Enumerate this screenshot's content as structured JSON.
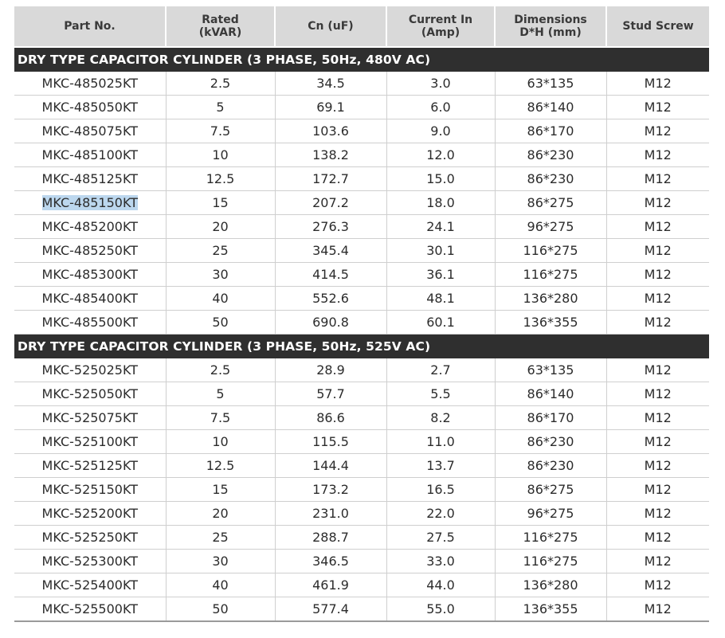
{
  "table": {
    "headers": {
      "part_no": "Part No.",
      "rated_1": "Rated",
      "rated_2": "(kVAR)",
      "cn": "Cn (uF)",
      "current_1": "Current In",
      "current_2": "(Amp)",
      "dims_1": "Dimensions",
      "dims_2": "D*H (mm)",
      "stud": "Stud Screw"
    },
    "sections": [
      {
        "title": "DRY TYPE CAPACITOR CYLINDER (3 PHASE, 50Hz, 480V AC)",
        "rows": [
          {
            "part": "MKC-485025KT",
            "rated": "2.5",
            "cn": "34.5",
            "current": "3.0",
            "dims": "63*135",
            "stud": "M12"
          },
          {
            "part": "MKC-485050KT",
            "rated": "5",
            "cn": "69.1",
            "current": "6.0",
            "dims": "86*140",
            "stud": "M12"
          },
          {
            "part": "MKC-485075KT",
            "rated": "7.5",
            "cn": "103.6",
            "current": "9.0",
            "dims": "86*170",
            "stud": "M12"
          },
          {
            "part": "MKC-485100KT",
            "rated": "10",
            "cn": "138.2",
            "current": "12.0",
            "dims": "86*230",
            "stud": "M12"
          },
          {
            "part": "MKC-485125KT",
            "rated": "12.5",
            "cn": "172.7",
            "current": "15.0",
            "dims": "86*230",
            "stud": "M12"
          },
          {
            "part": "MKC-485150KT",
            "rated": "15",
            "cn": "207.2",
            "current": "18.0",
            "dims": "86*275",
            "stud": "M12"
          },
          {
            "part": "MKC-485200KT",
            "rated": "20",
            "cn": "276.3",
            "current": "24.1",
            "dims": "96*275",
            "stud": "M12"
          },
          {
            "part": "MKC-485250KT",
            "rated": "25",
            "cn": "345.4",
            "current": "30.1",
            "dims": "116*275",
            "stud": "M12"
          },
          {
            "part": "MKC-485300KT",
            "rated": "30",
            "cn": "414.5",
            "current": "36.1",
            "dims": "116*275",
            "stud": "M12"
          },
          {
            "part": "MKC-485400KT",
            "rated": "40",
            "cn": "552.6",
            "current": "48.1",
            "dims": "136*280",
            "stud": "M12"
          },
          {
            "part": "MKC-485500KT",
            "rated": "50",
            "cn": "690.8",
            "current": "60.1",
            "dims": "136*355",
            "stud": "M12"
          }
        ]
      },
      {
        "title": "DRY TYPE CAPACITOR CYLINDER (3 PHASE, 50Hz, 525V AC)",
        "rows": [
          {
            "part": "MKC-525025KT",
            "rated": "2.5",
            "cn": "28.9",
            "current": "2.7",
            "dims": "63*135",
            "stud": "M12"
          },
          {
            "part": "MKC-525050KT",
            "rated": "5",
            "cn": "57.7",
            "current": "5.5",
            "dims": "86*140",
            "stud": "M12"
          },
          {
            "part": "MKC-525075KT",
            "rated": "7.5",
            "cn": "86.6",
            "current": "8.2",
            "dims": "86*170",
            "stud": "M12"
          },
          {
            "part": "MKC-525100KT",
            "rated": "10",
            "cn": "115.5",
            "current": "11.0",
            "dims": "86*230",
            "stud": "M12"
          },
          {
            "part": "MKC-525125KT",
            "rated": "12.5",
            "cn": "144.4",
            "current": "13.7",
            "dims": "86*230",
            "stud": "M12"
          },
          {
            "part": "MKC-525150KT",
            "rated": "15",
            "cn": "173.2",
            "current": "16.5",
            "dims": "86*275",
            "stud": "M12"
          },
          {
            "part": "MKC-525200KT",
            "rated": "20",
            "cn": "231.0",
            "current": "22.0",
            "dims": "96*275",
            "stud": "M12"
          },
          {
            "part": "MKC-525250KT",
            "rated": "25",
            "cn": "288.7",
            "current": "27.5",
            "dims": "116*275",
            "stud": "M12"
          },
          {
            "part": "MKC-525300KT",
            "rated": "30",
            "cn": "346.5",
            "current": "33.0",
            "dims": "116*275",
            "stud": "M12"
          },
          {
            "part": "MKC-525400KT",
            "rated": "40",
            "cn": "461.9",
            "current": "44.0",
            "dims": "136*280",
            "stud": "M12"
          },
          {
            "part": "MKC-525500KT",
            "rated": "50",
            "cn": "577.4",
            "current": "55.0",
            "dims": "136*355",
            "stud": "M12"
          }
        ]
      }
    ],
    "selected_text": "MKC-485150KT",
    "colors": {
      "header_bg": "#d9d9d9",
      "section_bg": "#2f2f2f",
      "selection_highlight": "#bcd7ee"
    }
  }
}
